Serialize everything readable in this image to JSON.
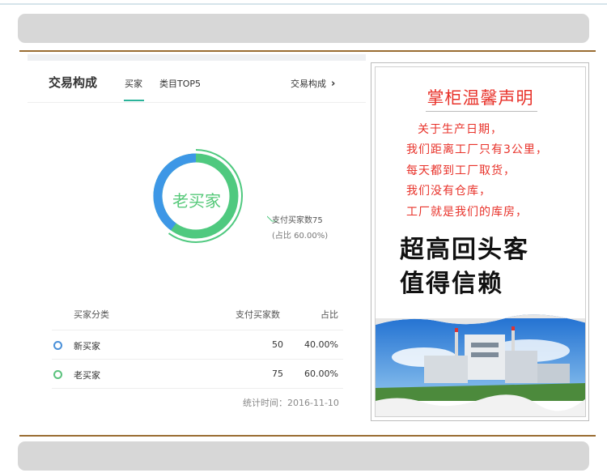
{
  "stats_card": {
    "title": "交易构成",
    "tabs": [
      {
        "label": "买家",
        "active": true
      },
      {
        "label": "类目TOP5",
        "active": false
      }
    ],
    "link_label": "交易构成",
    "donut": {
      "center_label": "老买家",
      "callout_line1": "支付买家数75",
      "callout_line2": "(占比 60.00%)"
    },
    "table": {
      "headers": [
        "买家分类",
        "支付买家数",
        "占比"
      ],
      "rows": [
        {
          "category": "新买家",
          "count": "50",
          "share": "40.00%",
          "color": "#4a90d9"
        },
        {
          "category": "老买家",
          "count": "75",
          "share": "60.00%",
          "color": "#5bc27d"
        }
      ]
    },
    "footer": "统计时间：2016-11-10"
  },
  "chart_data": {
    "type": "pie",
    "categories": [
      "新买家",
      "老买家"
    ],
    "values": [
      50,
      75
    ],
    "shares": [
      40.0,
      60.0
    ],
    "colors": [
      "#3d97e6",
      "#4fc97f"
    ]
  },
  "poster": {
    "title": "掌柜温馨声明",
    "lines": [
      "关于生产日期，",
      "我们距离工厂只有3公里，",
      "每天都到工厂取货，",
      "我们没有仓库，",
      "工厂就是我们的库房，"
    ],
    "slogan1": "超高回头客",
    "slogan2": "值得信赖"
  }
}
